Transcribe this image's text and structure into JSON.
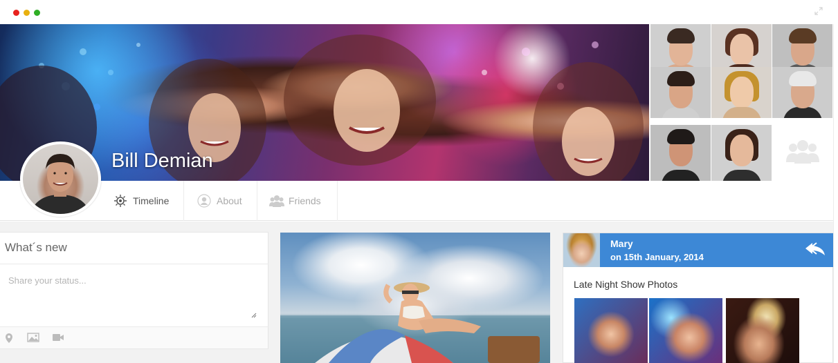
{
  "window": {
    "controls": [
      "close",
      "minimize",
      "maximize"
    ],
    "expand_icon": "expand-icon"
  },
  "profile": {
    "name": "Bill Demian"
  },
  "tabs": [
    {
      "label": "Timeline",
      "icon": "timeline-icon",
      "active": true
    },
    {
      "label": "About",
      "icon": "user-icon",
      "active": false
    },
    {
      "label": "Friends",
      "icon": "friends-icon",
      "active": false
    }
  ],
  "friends_grid": {
    "count_photos": 8,
    "placeholder_icon": "group-icon"
  },
  "status_box": {
    "title": "What´s new",
    "placeholder": "Share your status...",
    "tools": [
      "location-icon",
      "image-icon",
      "video-icon"
    ]
  },
  "post": {
    "author": "Mary",
    "date": "on 15th January, 2014",
    "caption": "Late Night Show Photos",
    "action_icon": "reply-all-icon"
  },
  "colors": {
    "accent_blue": "#3d88d6",
    "dot_red": "#e8221e",
    "dot_yellow": "#e8b00f",
    "dot_green": "#2fae25"
  }
}
